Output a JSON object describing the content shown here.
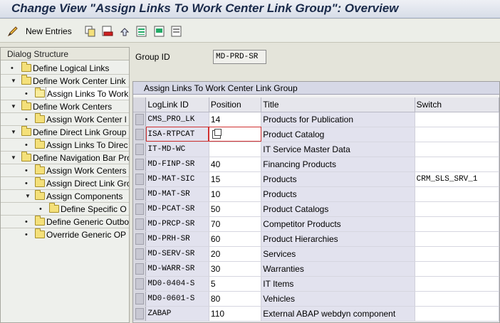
{
  "title": "Change View \"Assign Links To Work Center Link Group\": Overview",
  "toolbar": {
    "new_entries": "New Entries",
    "icons": [
      "copy-icon",
      "delete-icon",
      "undo-icon",
      "select-all-icon",
      "select-block-icon",
      "deselect-all-icon"
    ]
  },
  "tree": {
    "header": "Dialog Structure",
    "items": [
      {
        "label": "Define Logical Links",
        "level": 0,
        "expanded": false
      },
      {
        "label": "Define Work Center Link",
        "level": 0,
        "expanded": true
      },
      {
        "label": "Assign Links To Work",
        "level": 1,
        "selected": true
      },
      {
        "label": "Define Work Centers",
        "level": 0,
        "expanded": true
      },
      {
        "label": "Assign Work Center l",
        "level": 1
      },
      {
        "label": "Define Direct Link Group",
        "level": 0,
        "expanded": true
      },
      {
        "label": "Assign Links To Direc",
        "level": 1
      },
      {
        "label": "Define Navigation Bar Pro",
        "level": 0,
        "expanded": true
      },
      {
        "label": "Assign Work Centers",
        "level": 1
      },
      {
        "label": "Assign Direct Link Gro",
        "level": 1
      },
      {
        "label": "Assign Components",
        "level": 1,
        "expanded": true
      },
      {
        "label": "Define Specific O",
        "level": 2
      },
      {
        "label": "Define Generic Outbo",
        "level": 1
      },
      {
        "label": "Override Generic OP",
        "level": 1
      }
    ]
  },
  "group": {
    "label": "Group ID",
    "value": "MD-PRD-SR"
  },
  "table": {
    "caption": "Assign Links To Work Center Link Group",
    "headers": {
      "id": "LogLink ID",
      "pos": "Position",
      "title": "Title",
      "sw": "Switch"
    },
    "rows": [
      {
        "id": "CMS_PRO_LK",
        "pos": "14",
        "title": "Products for Publication",
        "sw": ""
      },
      {
        "id": "ISA-RTPCAT",
        "pos": "",
        "title": "Product Catalog",
        "sw": ""
      },
      {
        "id": "IT-MD-WC",
        "pos": "",
        "title": "IT Service Master Data",
        "sw": ""
      },
      {
        "id": "MD-FINP-SR",
        "pos": "40",
        "title": "Financing Products",
        "sw": ""
      },
      {
        "id": "MD-MAT-SIC",
        "pos": "15",
        "title": "Products",
        "sw": "CRM_SLS_SRV_1"
      },
      {
        "id": "MD-MAT-SR",
        "pos": "10",
        "title": "Products",
        "sw": ""
      },
      {
        "id": "MD-PCAT-SR",
        "pos": "50",
        "title": "Product Catalogs",
        "sw": ""
      },
      {
        "id": "MD-PRCP-SR",
        "pos": "70",
        "title": "Competitor Products",
        "sw": ""
      },
      {
        "id": "MD-PRH-SR",
        "pos": "60",
        "title": "Product Hierarchies",
        "sw": ""
      },
      {
        "id": "MD-SERV-SR",
        "pos": "20",
        "title": "Services",
        "sw": ""
      },
      {
        "id": "MD-WARR-SR",
        "pos": "30",
        "title": "Warranties",
        "sw": ""
      },
      {
        "id": "MD0-0404-S",
        "pos": "5",
        "title": "IT Items",
        "sw": ""
      },
      {
        "id": "MD0-0601-S",
        "pos": "80",
        "title": "Vehicles",
        "sw": ""
      },
      {
        "id": "ZABAP",
        "pos": "110",
        "title": "External ABAP webdyn component",
        "sw": ""
      }
    ]
  },
  "colors": {
    "title_bar": "#d7dde8",
    "table_header": "#d6d8e6",
    "error_border": "#d03030"
  }
}
